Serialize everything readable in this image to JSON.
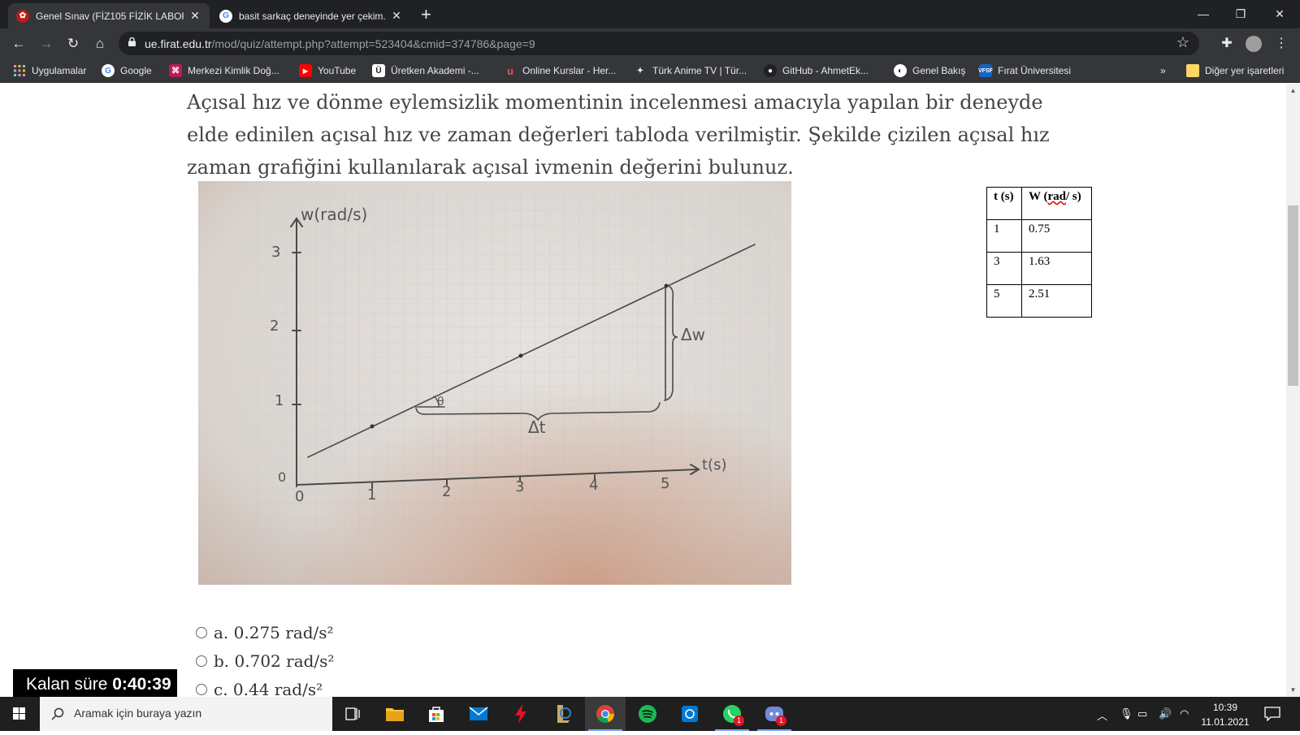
{
  "browser": {
    "tabs": [
      {
        "title": "Genel Sınav (FİZ105 FİZİK LABOR...",
        "active": true
      },
      {
        "title": "basit sarkaç deneyinde yer çekim...",
        "active": false
      }
    ],
    "url_host": "ue.firat.edu.tr",
    "url_path": "/mod/quiz/attempt.php?attempt=523404&cmid=374786&page=9",
    "bookmarks": [
      {
        "label": "Uygulamalar",
        "icon": "apps-grid-icon"
      },
      {
        "label": "Google",
        "icon": "google-icon"
      },
      {
        "label": "Merkezi Kimlik Doğ...",
        "icon": "kimlik-icon"
      },
      {
        "label": "YouTube",
        "icon": "youtube-icon"
      },
      {
        "label": "Üretken Akademi -...",
        "icon": "uretken-icon"
      },
      {
        "label": "Online Kurslar - Her...",
        "icon": "udemy-icon"
      },
      {
        "label": "Türk Anime TV | Tür...",
        "icon": "anime-icon"
      },
      {
        "label": "GitHub - AhmetEk...",
        "icon": "github-icon"
      },
      {
        "label": "Genel Bakış",
        "icon": "genel-bakis-icon"
      },
      {
        "label": "Fırat Üniversitesi",
        "icon": "firat-icon"
      }
    ],
    "bookmarks_more": "»",
    "other_bookmarks": "Diğer yer işaretleri"
  },
  "question": {
    "text": "Açısal hız ve dönme eylemsizlik momentinin incelenmesi amacıyla yapılan bir deneyde elde edinilen açısal hız ve zaman değerleri tabloda verilmiştir. Şekilde çizilen açısal hız zaman grafiğini kullanılarak açısal ivmenin değerini bulunuz."
  },
  "sketch": {
    "ylabel": "w(rad/s)",
    "xlabel": "t(s)",
    "yticks": [
      "3",
      "2",
      "1",
      "0"
    ],
    "xticks": [
      "0",
      "1",
      "2",
      "3",
      "4",
      "5"
    ],
    "delta_w": "Δw",
    "delta_t": "Δt",
    "theta": "θ"
  },
  "table": {
    "header_t": "t (s)",
    "header_w_prefix": "W (",
    "header_w_unit": "rad",
    "header_w_suffix": "/ s)",
    "rows": [
      {
        "t": "1",
        "w": "0.75"
      },
      {
        "t": "3",
        "w": "1.63"
      },
      {
        "t": "5",
        "w": "2.51"
      }
    ]
  },
  "options": [
    {
      "label": "a. 0.275 rad/s²"
    },
    {
      "label": "b. 0.702  rad/s²"
    },
    {
      "label": "c. 0.44  rad/s²"
    }
  ],
  "timer": {
    "label": "Kalan süre",
    "value": "0:40:39"
  },
  "taskbar": {
    "search_placeholder": "Aramak için buraya yazın",
    "time": "10:39",
    "date": "11.01.2021"
  }
}
